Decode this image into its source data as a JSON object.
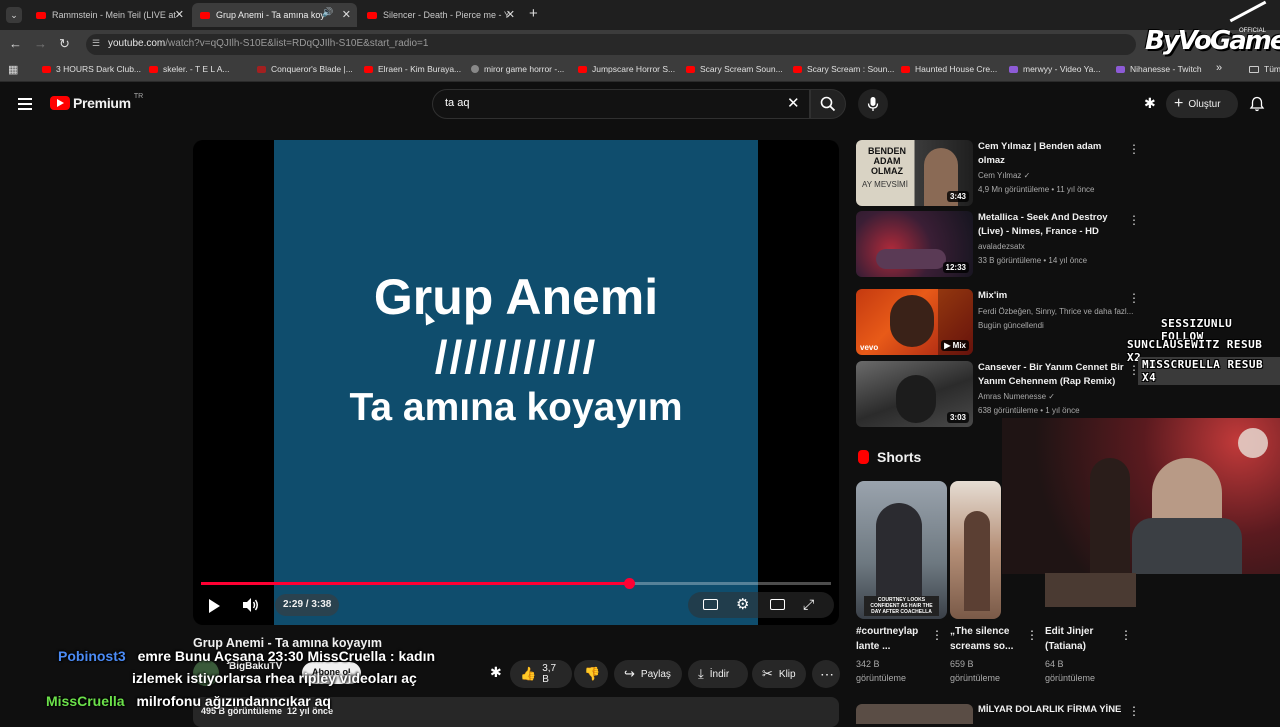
{
  "browser": {
    "tabs": [
      {
        "title": "Rammstein - Mein Teil (LIVE at"
      },
      {
        "title": "Grup Anemi - Ta amına koy"
      },
      {
        "title": "Silencer - Death - Pierce me - Y"
      }
    ],
    "new_tab": "+",
    "url_host": "youtube.com",
    "url_rest": "/watch?v=qQJIlh-S10E&list=RDqQJIlh-S10E&start_radio=1",
    "bookmarks": [
      "3 HOURS Dark Club...",
      "skeler. - T E L A...",
      "Conqueror's Blade |...",
      "Elraen - Kim Buraya...",
      "miror game horror -...",
      "Jumpscare Horror S...",
      "Scary Scream Soun...",
      "Scary Scream : Soun...",
      "Haunted House Cre...",
      "merwyy - Video Ya...",
      "Nihanesse - Twitch"
    ],
    "bookmarks_more": "»",
    "bookmarks_folder": "Tüm"
  },
  "youtube": {
    "logo": "Premium",
    "logo_badge": "TR",
    "search_value": "ta aq",
    "create_label": "Oluştur"
  },
  "player": {
    "slide_line1": "Grup Anemi",
    "slide_line2": "///////////",
    "slide_line3": "Ta amına koyayım",
    "time": "2:29 / 3:38",
    "progress": 0.68
  },
  "video": {
    "title": "Grup Anemi - Ta amına koyayım",
    "channel": "BigBakuTV",
    "subscribe": "Abone ol",
    "likes": "3,7 B",
    "share": "Paylaş",
    "download": "İndir",
    "clip": "Klip",
    "views": "495 B görüntüleme",
    "age": "12 yıl önce"
  },
  "recommendations": [
    {
      "title": "Cem Yılmaz | Benden adam olmaz",
      "channel": "Cem Yılmaz",
      "meta": "4,9 Mn görüntüleme • 11 yıl önce",
      "duration": "3:43",
      "thumb_text": "BENDEN ADAM OLMAZ",
      "thumb_sub": "AY MEVSİMİ"
    },
    {
      "title": "Metallica - Seek And Destroy (Live) - Nimes, France - HD",
      "channel": "avaladezsatx",
      "meta": "33 B görüntüleme • 14 yıl önce",
      "duration": "12:33"
    },
    {
      "title": "Mix'im",
      "channel": "Ferdi Özbeğen, Sinny, Thrice ve daha fazl...",
      "meta": "Bugün güncellendi",
      "duration": "Mix",
      "thumb_text": "vevo"
    },
    {
      "title": "Cansever - Bir Yanım Cennet Bir Yanım Cehennem (Rap Remix)",
      "channel": "Amras Numenesse",
      "meta": "638 görüntüleme • 1 yıl önce",
      "duration": "3:03"
    }
  ],
  "shorts": {
    "heading": "Shorts",
    "items": [
      {
        "title": "#courtneylap lante ...",
        "views": "342 B",
        "unit": "görüntüleme",
        "thumb_text": "COURTNEY LOOKS CONFIDENT AS HAIR THE DAY AFTER COACHELLA"
      },
      {
        "title": "„The silence screams so...",
        "views": "659 B",
        "unit": "görüntüleme"
      },
      {
        "title": "Edit Jinjer (Tatiana)",
        "views": "64 B",
        "unit": "görüntüleme"
      }
    ]
  },
  "next_rec_title": "MİLYAR DOLARLIK FİRMA YİNE",
  "overlay": {
    "watermark": "ByVoGame",
    "watermark_small": "OFFICIAL",
    "alerts": [
      "SESSIZUNLU FOLLOW",
      "SUNCLAUSEWITZ RESUB X2",
      "MISSCRUELLA RESUB X4"
    ],
    "chat": [
      {
        "user": "Pobinost3",
        "color": "#4b8bf5",
        "line1": "emre Bunu Açsana 23:30 MissCruella : kadın",
        "line2": "izlemek istiyorlarsa rhea ripley videoları aç"
      },
      {
        "user": "MissCruella",
        "color": "#6be04a",
        "line1": "milrofonu ağızındanncıkar aq"
      }
    ]
  },
  "colors": {
    "accent": "#ff0033",
    "slide_bg": "#0f4d6d",
    "page_bg": "#0f0f0f"
  }
}
